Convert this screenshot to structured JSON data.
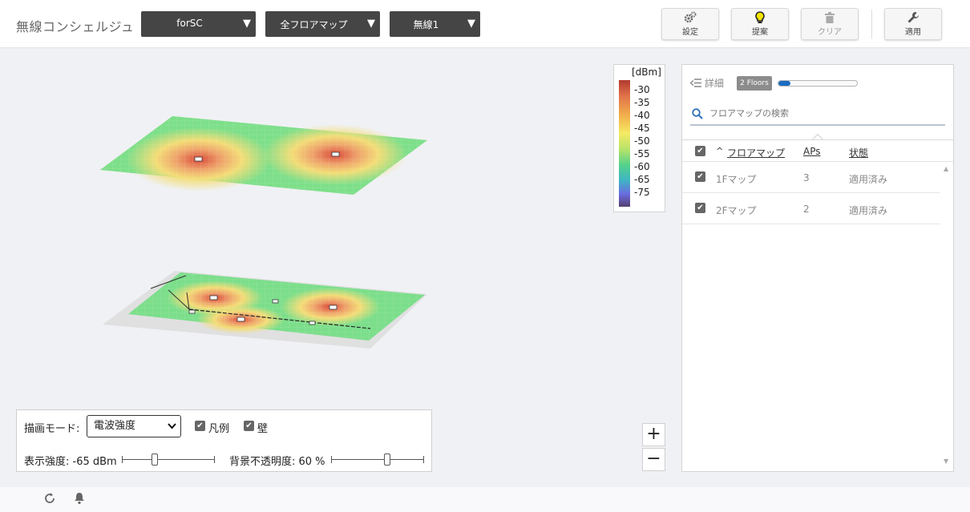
{
  "header": {
    "app_title": "無線コンシェルジュ",
    "dropdowns": [
      {
        "label": "forSC"
      },
      {
        "label": "全フロアマップ"
      },
      {
        "label": "無線1"
      }
    ],
    "toolbar": {
      "settings": {
        "label": "設定",
        "icon": "gears-icon"
      },
      "suggest": {
        "label": "提案",
        "icon": "lightbulb-icon"
      },
      "clear": {
        "label": "クリア",
        "icon": "trash-icon"
      },
      "apply": {
        "label": "適用",
        "icon": "wrench-icon"
      }
    }
  },
  "legend": {
    "unit": "[dBm]",
    "ticks": [
      "-30",
      "-35",
      "-40",
      "-45",
      "-50",
      "-55",
      "-60",
      "-65",
      "-75"
    ]
  },
  "panel": {
    "detail_label": "詳細",
    "floors_badge": "2 Floors",
    "progress": 0.15,
    "search_placeholder": "フロアマップの検索",
    "columns": {
      "sort_indicator": "^",
      "floor_map": "フロアマップ",
      "aps": "APs",
      "status": "状態"
    },
    "rows": [
      {
        "name": "1Fマップ",
        "aps": "3",
        "status": "適用済み",
        "checked": true
      },
      {
        "name": "2Fマップ",
        "aps": "2",
        "status": "適用済み",
        "checked": true
      }
    ]
  },
  "controls": {
    "mode_label": "描画モード:",
    "mode_value": "電波強度",
    "legend_label": "凡例",
    "wall_label": "壁",
    "strength_label": "表示強度: -65 dBm",
    "strength_fraction": 0.35,
    "opacity_label": "背景不透明度: 60 %",
    "opacity_fraction": 0.6
  },
  "zoom": {
    "in": "+",
    "out": "−"
  },
  "colors": {
    "dropdown_bg": "#454545",
    "accent": "#1a6bc2"
  }
}
